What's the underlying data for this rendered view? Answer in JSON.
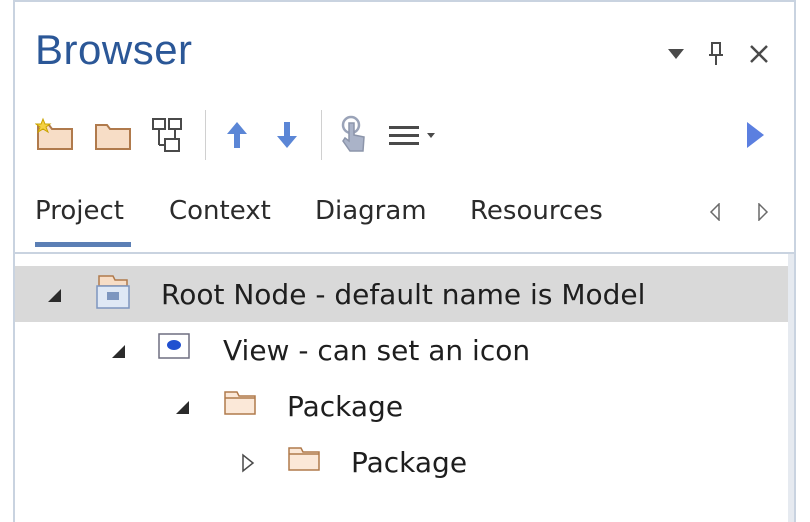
{
  "panel": {
    "title": "Browser",
    "controls": {
      "dropdown_icon": "dropdown-triangle-icon",
      "pin_icon": "pin-icon",
      "close_icon": "close-icon"
    }
  },
  "toolbar": {
    "buttons": [
      {
        "name": "new-root-package-button",
        "icon": "new-folder-star-icon"
      },
      {
        "name": "new-package-button",
        "icon": "folder-icon"
      },
      {
        "name": "new-element-button",
        "icon": "element-tree-icon"
      },
      {
        "name": "move-up-button",
        "icon": "arrow-up-icon"
      },
      {
        "name": "move-down-button",
        "icon": "arrow-down-icon"
      },
      {
        "name": "touch-icon-button",
        "icon": "touch-icon"
      },
      {
        "name": "menu-button",
        "icon": "hamburger-menu-icon"
      },
      {
        "name": "more-button",
        "icon": "play-right-icon"
      }
    ]
  },
  "tabs": [
    {
      "label": "Project",
      "active": true
    },
    {
      "label": "Context",
      "active": false
    },
    {
      "label": "Diagram",
      "active": false
    },
    {
      "label": "Resources",
      "active": false
    }
  ],
  "tree": [
    {
      "label": "Root Node - default name is Model",
      "expanded": true,
      "icon": "root-node-icon",
      "selected": true
    },
    {
      "label": "View - can set an icon",
      "expanded": true,
      "icon": "view-icon",
      "selected": false
    },
    {
      "label": "Package",
      "expanded": true,
      "icon": "package-folder-icon",
      "selected": false
    },
    {
      "label": "Package",
      "expanded": false,
      "icon": "package-folder-icon",
      "selected": false
    }
  ],
  "colors": {
    "title": "#2b5797",
    "accent_blue": "#5b7fb5",
    "selection": "#d9d9d9",
    "folder_fill": "#f7ddc6",
    "folder_stroke": "#c8966a"
  }
}
